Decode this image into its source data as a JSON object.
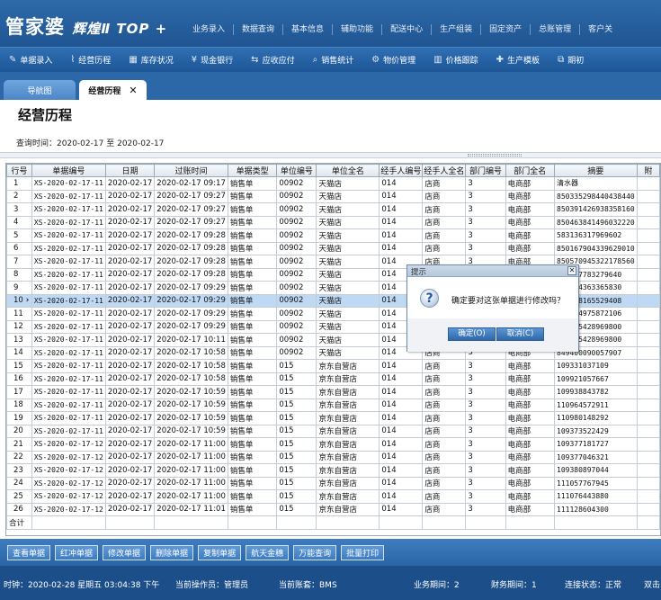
{
  "header": {
    "logo_main": "管家婆",
    "logo_sub": "辉煌Ⅱ TOP +",
    "nav": [
      "业务录入",
      "数据查询",
      "基本信息",
      "辅助功能",
      "配送中心",
      "生产组装",
      "固定资产",
      "总账管理",
      "客户关"
    ]
  },
  "toolbar": {
    "items": [
      {
        "label": "单据录入",
        "icon": "document-edit-icon",
        "glyph": "✎"
      },
      {
        "label": "经营历程",
        "icon": "line-chart-icon",
        "glyph": "⌇"
      },
      {
        "label": "库存状况",
        "icon": "warehouse-icon",
        "glyph": "▦"
      },
      {
        "label": "现金银行",
        "icon": "yen-icon",
        "glyph": "¥"
      },
      {
        "label": "应收应付",
        "icon": "transfer-icon",
        "glyph": "⇆"
      },
      {
        "label": "销售统计",
        "icon": "search-icon",
        "glyph": "⌕"
      },
      {
        "label": "物价管理",
        "icon": "gear-icon",
        "glyph": "⚙"
      },
      {
        "label": "价格跟踪",
        "icon": "bar-chart-icon",
        "glyph": "▥"
      },
      {
        "label": "生产模板",
        "icon": "pin-icon",
        "glyph": "✚"
      },
      {
        "label": "期初",
        "icon": "external-icon",
        "glyph": "⧉"
      }
    ]
  },
  "tabs": {
    "nav_label": "导航图",
    "active_label": "经营历程",
    "close_glyph": "✕"
  },
  "page": {
    "title": "经营历程",
    "query_label": "查询时间：",
    "query_from": "2020-02-17",
    "query_to_word": "至",
    "query_to": "2020-02-17"
  },
  "table": {
    "columns": [
      "行号",
      "单据编号",
      "日期",
      "过账时间",
      "单据类型",
      "单位编号",
      "单位全名",
      "经手人编号",
      "经手人全名",
      "部门编号",
      "部门全名",
      "摘要",
      "附"
    ],
    "selected_row": 10,
    "rows": [
      [
        "1",
        "XS-2020-02-17-11",
        "2020-02-17",
        "2020-02-17 09:17",
        "销售单",
        "00902",
        "天猫店",
        "014",
        "店商",
        "3",
        "电商部",
        "清水器"
      ],
      [
        "2",
        "XS-2020-02-17-11",
        "2020-02-17",
        "2020-02-17 09:27",
        "销售单",
        "00902",
        "天猫店",
        "014",
        "店商",
        "3",
        "电商部",
        "850335298440438440"
      ],
      [
        "3",
        "XS-2020-02-17-11",
        "2020-02-17",
        "2020-02-17 09:27",
        "销售单",
        "00902",
        "天猫店",
        "014",
        "店商",
        "3",
        "电商部",
        "850391426938358160"
      ],
      [
        "4",
        "XS-2020-02-17-11",
        "2020-02-17",
        "2020-02-17 09:27",
        "销售单",
        "00902",
        "天猫店",
        "014",
        "店商",
        "3",
        "电商部",
        "850463841496032220"
      ],
      [
        "5",
        "XS-2020-02-17-11",
        "2020-02-17",
        "2020-02-17 09:28",
        "销售单",
        "00902",
        "天猫店",
        "014",
        "店商",
        "3",
        "电商部",
        "583136317969602"
      ],
      [
        "6",
        "XS-2020-02-17-11",
        "2020-02-17",
        "2020-02-17 09:28",
        "销售单",
        "00902",
        "天猫店",
        "014",
        "店商",
        "3",
        "电商部",
        "850167904339629010"
      ],
      [
        "7",
        "XS-2020-02-17-11",
        "2020-02-17",
        "2020-02-17 09:28",
        "销售单",
        "00902",
        "天猫店",
        "014",
        "店商",
        "3",
        "电商部",
        "850570945322178560"
      ],
      [
        "8",
        "XS-2020-02-17-11",
        "2020-02-17",
        "2020-02-17 09:28",
        "销售单",
        "00902",
        "天猫店",
        "014",
        "店商",
        "3",
        "电商部",
        "849137783279640"
      ],
      [
        "9",
        "XS-2020-02-17-11",
        "2020-02-17",
        "2020-02-17 09:29",
        "销售单",
        "00902",
        "天猫店",
        "014",
        "店商",
        "3",
        "电商部",
        "849744363365830"
      ],
      [
        "10",
        "XS-2020-02-17-11",
        "2020-02-17",
        "2020-02-17 09:29",
        "销售单",
        "00902",
        "天猫店",
        "014",
        "店商",
        "3",
        "电商部",
        "849628165529408"
      ],
      [
        "11",
        "XS-2020-02-17-11",
        "2020-02-17",
        "2020-02-17 09:29",
        "销售单",
        "00902",
        "天猫店",
        "014",
        "店商",
        "3",
        "电商部",
        "849804975872106"
      ],
      [
        "12",
        "XS-2020-02-17-11",
        "2020-02-17",
        "2020-02-17 09:29",
        "销售单",
        "00902",
        "天猫店",
        "014",
        "店商",
        "3",
        "电商部",
        "848995428969800"
      ],
      [
        "13",
        "XS-2020-02-17-11",
        "2020-02-17",
        "2020-02-17 10:11",
        "销售单",
        "00902",
        "天猫店",
        "014",
        "店商",
        "3",
        "电商部",
        "848895428969800"
      ],
      [
        "14",
        "XS-2020-02-17-11",
        "2020-02-17",
        "2020-02-17 10:58",
        "销售单",
        "00902",
        "天猫店",
        "014",
        "店商",
        "3",
        "电商部",
        "849400090057907"
      ],
      [
        "15",
        "XS-2020-02-17-11",
        "2020-02-17",
        "2020-02-17 10:58",
        "销售单",
        "015",
        "京东自营店",
        "014",
        "店商",
        "3",
        "电商部",
        "109331037109"
      ],
      [
        "16",
        "XS-2020-02-17-11",
        "2020-02-17",
        "2020-02-17 10:58",
        "销售单",
        "015",
        "京东自营店",
        "014",
        "店商",
        "3",
        "电商部",
        "109921057667"
      ],
      [
        "17",
        "XS-2020-02-17-11",
        "2020-02-17",
        "2020-02-17 10:59",
        "销售单",
        "015",
        "京东自营店",
        "014",
        "店商",
        "3",
        "电商部",
        "109938843782"
      ],
      [
        "18",
        "XS-2020-02-17-11",
        "2020-02-17",
        "2020-02-17 10:59",
        "销售单",
        "015",
        "京东自营店",
        "014",
        "店商",
        "3",
        "电商部",
        "110964572911"
      ],
      [
        "19",
        "XS-2020-02-17-11",
        "2020-02-17",
        "2020-02-17 10:59",
        "销售单",
        "015",
        "京东自营店",
        "014",
        "店商",
        "3",
        "电商部",
        "110980148292"
      ],
      [
        "20",
        "XS-2020-02-17-11",
        "2020-02-17",
        "2020-02-17 10:59",
        "销售单",
        "015",
        "京东自营店",
        "014",
        "店商",
        "3",
        "电商部",
        "109373522429"
      ],
      [
        "21",
        "XS-2020-02-17-12",
        "2020-02-17",
        "2020-02-17 11:00",
        "销售单",
        "015",
        "京东自营店",
        "014",
        "店商",
        "3",
        "电商部",
        "109377181727"
      ],
      [
        "22",
        "XS-2020-02-17-12",
        "2020-02-17",
        "2020-02-17 11:00",
        "销售单",
        "015",
        "京东自营店",
        "014",
        "店商",
        "3",
        "电商部",
        "109377046321"
      ],
      [
        "23",
        "XS-2020-02-17-12",
        "2020-02-17",
        "2020-02-17 11:00",
        "销售单",
        "015",
        "京东自营店",
        "014",
        "店商",
        "3",
        "电商部",
        "109380897044"
      ],
      [
        "24",
        "XS-2020-02-17-12",
        "2020-02-17",
        "2020-02-17 11:00",
        "销售单",
        "015",
        "京东自营店",
        "014",
        "店商",
        "3",
        "电商部",
        "111057767945"
      ],
      [
        "25",
        "XS-2020-02-17-12",
        "2020-02-17",
        "2020-02-17 11:00",
        "销售单",
        "015",
        "京东自营店",
        "014",
        "店商",
        "3",
        "电商部",
        "111076443880"
      ],
      [
        "26",
        "XS-2020-02-17-12",
        "2020-02-17",
        "2020-02-17 11:01",
        "销售单",
        "015",
        "京东自营店",
        "014",
        "店商",
        "3",
        "电商部",
        "111128604300"
      ]
    ],
    "sum_label": "合计"
  },
  "buttons": [
    "查看单据",
    "红冲单据",
    "修改单据",
    "删除单据",
    "复制单据",
    "航天金穗",
    "万能查询",
    "批量打印"
  ],
  "status": {
    "time": "时钟：2020-02-28 星期五 03:04:38 下午",
    "operator": "当前操作员：管理员",
    "account": "当前账套：BMS",
    "period": "业务期间：2",
    "fin_period": "财务期间：1",
    "connection": "连接状态：正常",
    "extra": "双击"
  },
  "dialog": {
    "title": "提示",
    "close_glyph": "✕",
    "icon_glyph": "?",
    "message": "确定要对这张单据进行修改吗？",
    "ok_label": "确定(O)",
    "cancel_label": "取消(C)"
  },
  "colors": {
    "header_blue": "#1f5592",
    "selected_row": "#bfd9f5",
    "status_bar": "#1c4f8a"
  }
}
